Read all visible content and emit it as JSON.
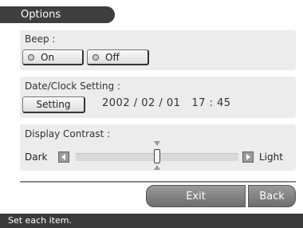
{
  "title": "Options",
  "beep": {
    "label": "Beep :",
    "on_label": "On",
    "off_label": "Off"
  },
  "date_clock": {
    "label": "Date/Clock Setting :",
    "setting_label": "Setting",
    "value": "2002 / 02 / 01   17 : 45"
  },
  "contrast": {
    "label": "Display Contrast :",
    "dark_label": "Dark",
    "light_label": "Light",
    "level": 0.5
  },
  "footer": {
    "exit_label": "Exit",
    "back_label": "Back"
  },
  "status": "Set each item."
}
